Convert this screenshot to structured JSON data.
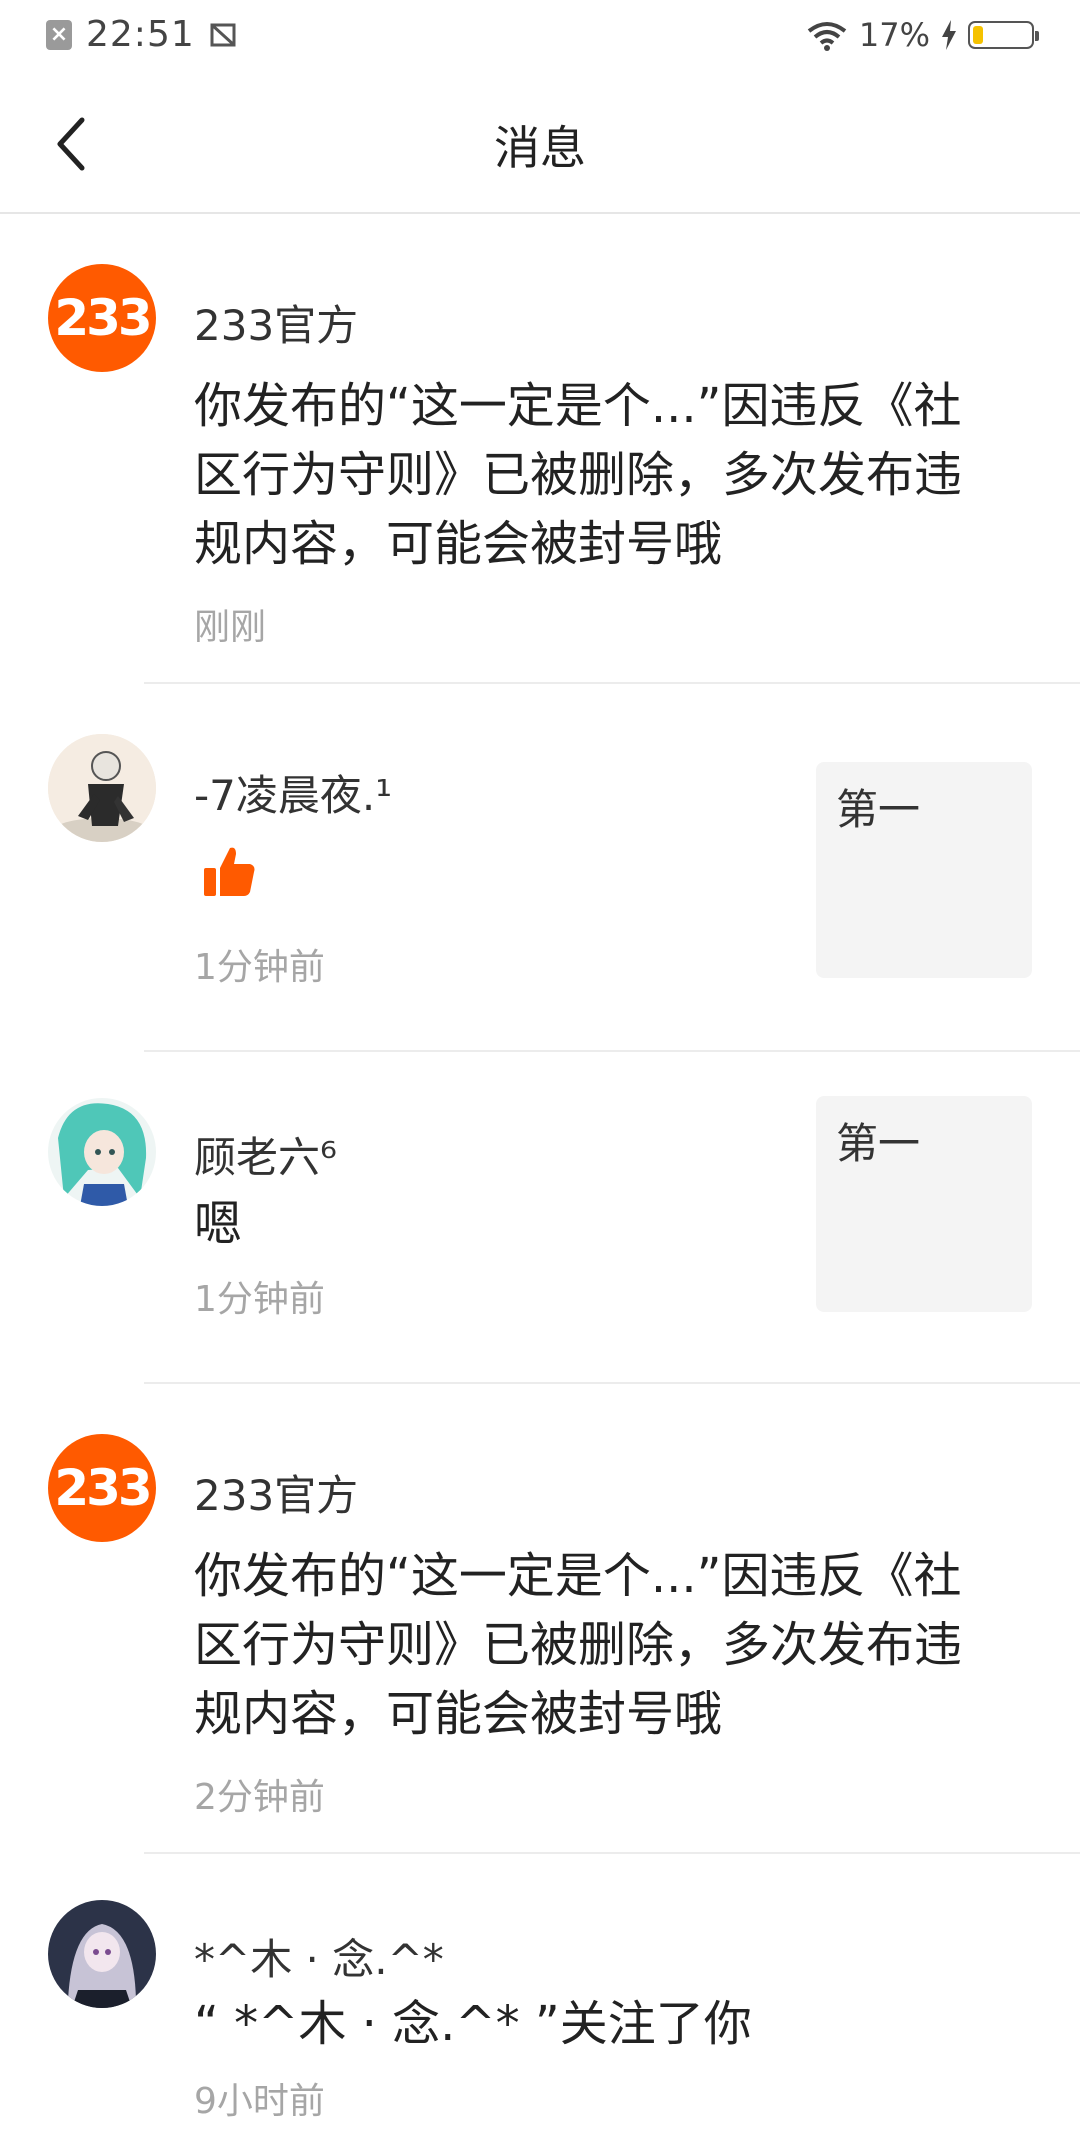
{
  "status_bar": {
    "time": "22:51",
    "battery_percent": "17%",
    "battery_level": 0.17,
    "accent_battery": "#f5c200"
  },
  "header": {
    "title": "消息"
  },
  "colors": {
    "brand": "#ff5a00",
    "time_text": "#a6a6a6",
    "divider": "#ececec"
  },
  "messages": [
    {
      "avatar_text": "233",
      "username": "233官方",
      "content": "你发布的“这一定是个...”因违反《社区行为守则》已被删除，多次发布违规内容，可能会被封号哦",
      "time": "刚刚"
    },
    {
      "username": "-7凌晨夜.¹",
      "icon": "thumbs-up-icon",
      "thumb_text": "第一",
      "time": "1分钟前"
    },
    {
      "username": "顾老六⁶",
      "content": "嗯",
      "thumb_text": "第一",
      "time": "1分钟前"
    },
    {
      "avatar_text": "233",
      "username": "233官方",
      "content": "你发布的“这一定是个...”因违反《社区行为守则》已被删除，多次发布违规内容，可能会被封号哦",
      "time": "2分钟前"
    },
    {
      "username": "*^木 · 念.^*",
      "content": "“ *^木 · 念.^* ”关注了你",
      "time": "9小时前"
    }
  ]
}
